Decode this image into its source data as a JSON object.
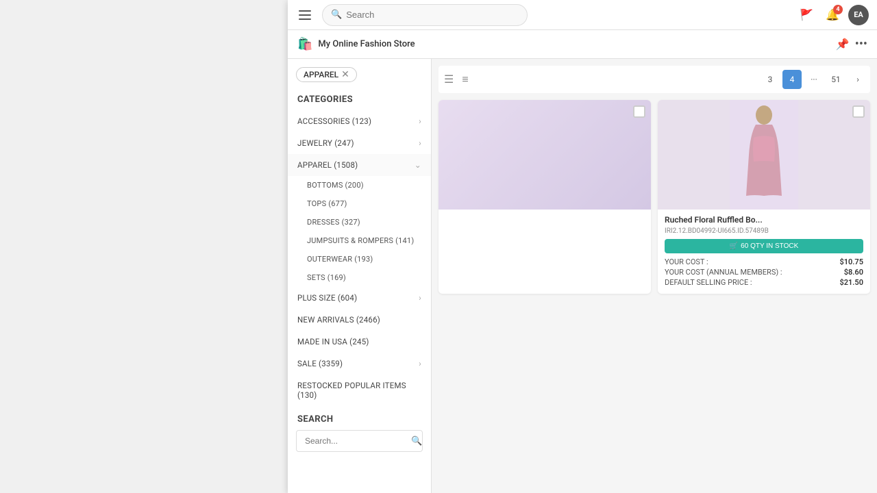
{
  "topNav": {
    "searchPlaceholder": "Search",
    "flagBadge": "",
    "bellBadge": "4",
    "avatarLabel": "EA"
  },
  "subNav": {
    "storeIcon": "🛍️",
    "storeName": "My Online Fashion Store"
  },
  "sidebar": {
    "filterChip": "APPAREL",
    "categoriesLabel": "CATEGORIES",
    "categories": [
      {
        "label": "ACCESSORIES (123)",
        "count": 123,
        "hasChildren": false,
        "expanded": false
      },
      {
        "label": "JEWELRY (247)",
        "count": 247,
        "hasChildren": false,
        "expanded": false
      },
      {
        "label": "APPAREL (1508)",
        "count": 1508,
        "hasChildren": true,
        "expanded": true
      },
      {
        "label": "PLUS SIZE (604)",
        "count": 604,
        "hasChildren": false,
        "expanded": false
      },
      {
        "label": "NEW ARRIVALS (2466)",
        "count": 2466,
        "hasChildren": false,
        "expanded": false
      },
      {
        "label": "MADE IN USA (245)",
        "count": 245,
        "hasChildren": false,
        "expanded": false
      },
      {
        "label": "SALE (3359)",
        "count": 3359,
        "hasChildren": false,
        "expanded": false
      },
      {
        "label": "RESTOCKED POPULAR ITEMS (130)",
        "count": 130,
        "hasChildren": false,
        "expanded": false
      }
    ],
    "subcategories": [
      "BOTTOMS (200)",
      "TOPS (677)",
      "DRESSES (327)",
      "JUMPSUITS & ROMPERS (141)",
      "OUTERWEAR (193)",
      "SETS (169)"
    ],
    "searchLabel": "SEARCH",
    "searchPlaceholder": "Search..."
  },
  "pagination": {
    "pages": [
      "3",
      "4",
      "···",
      "51"
    ],
    "activePage": "4",
    "nextLabel": "›"
  },
  "viewButtons": {
    "grid": "☰",
    "list": "≡"
  },
  "products": [
    {
      "title": "Ruched Floral Ruffled Bo...",
      "sku": "IRI2.12.BD04992-UI665.ID.57489B",
      "stock": "60 QTY IN STOCK",
      "yourCost": "$10.75",
      "annualCost": "$8.60",
      "defaultPrice": "$21.50"
    }
  ],
  "productLabels": {
    "yourCost": "YOUR COST :",
    "annualCost": "YOUR COST (ANNUAL MEMBERS) :",
    "defaultPrice": "DEFAULT SELLING PRICE :"
  }
}
